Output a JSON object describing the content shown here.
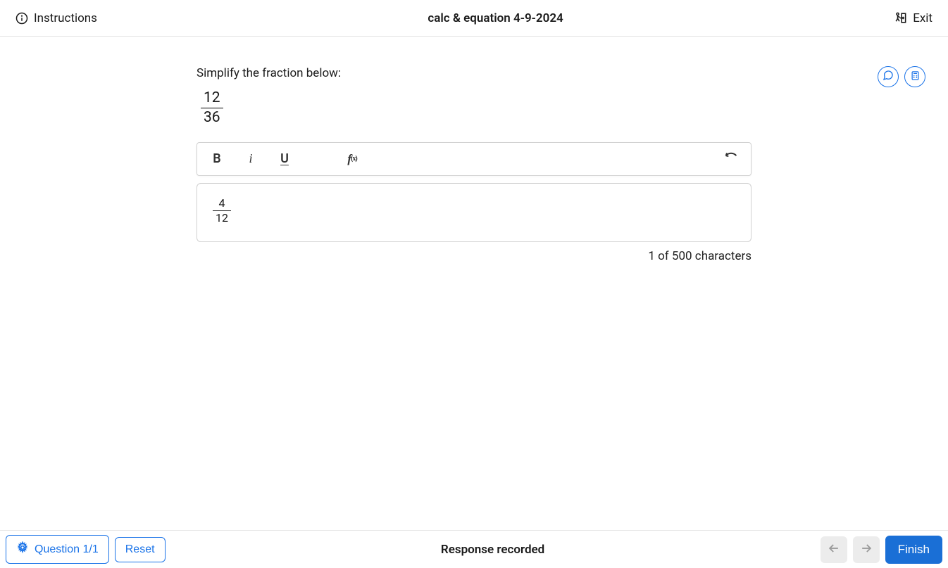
{
  "header": {
    "instructions_label": "Instructions",
    "title": "calc & equation 4-9-2024",
    "exit_label": "Exit"
  },
  "question": {
    "prompt": "Simplify the fraction below:",
    "fraction_numerator": "12",
    "fraction_denominator": "36"
  },
  "toolbar": {
    "bold": "B",
    "italic": "i",
    "underline": "U"
  },
  "answer": {
    "fraction_numerator": "4",
    "fraction_denominator": "12"
  },
  "char_count": "1 of 500 characters",
  "footer": {
    "question_nav": "Question 1/1",
    "reset": "Reset",
    "status": "Response recorded",
    "finish": "Finish"
  }
}
